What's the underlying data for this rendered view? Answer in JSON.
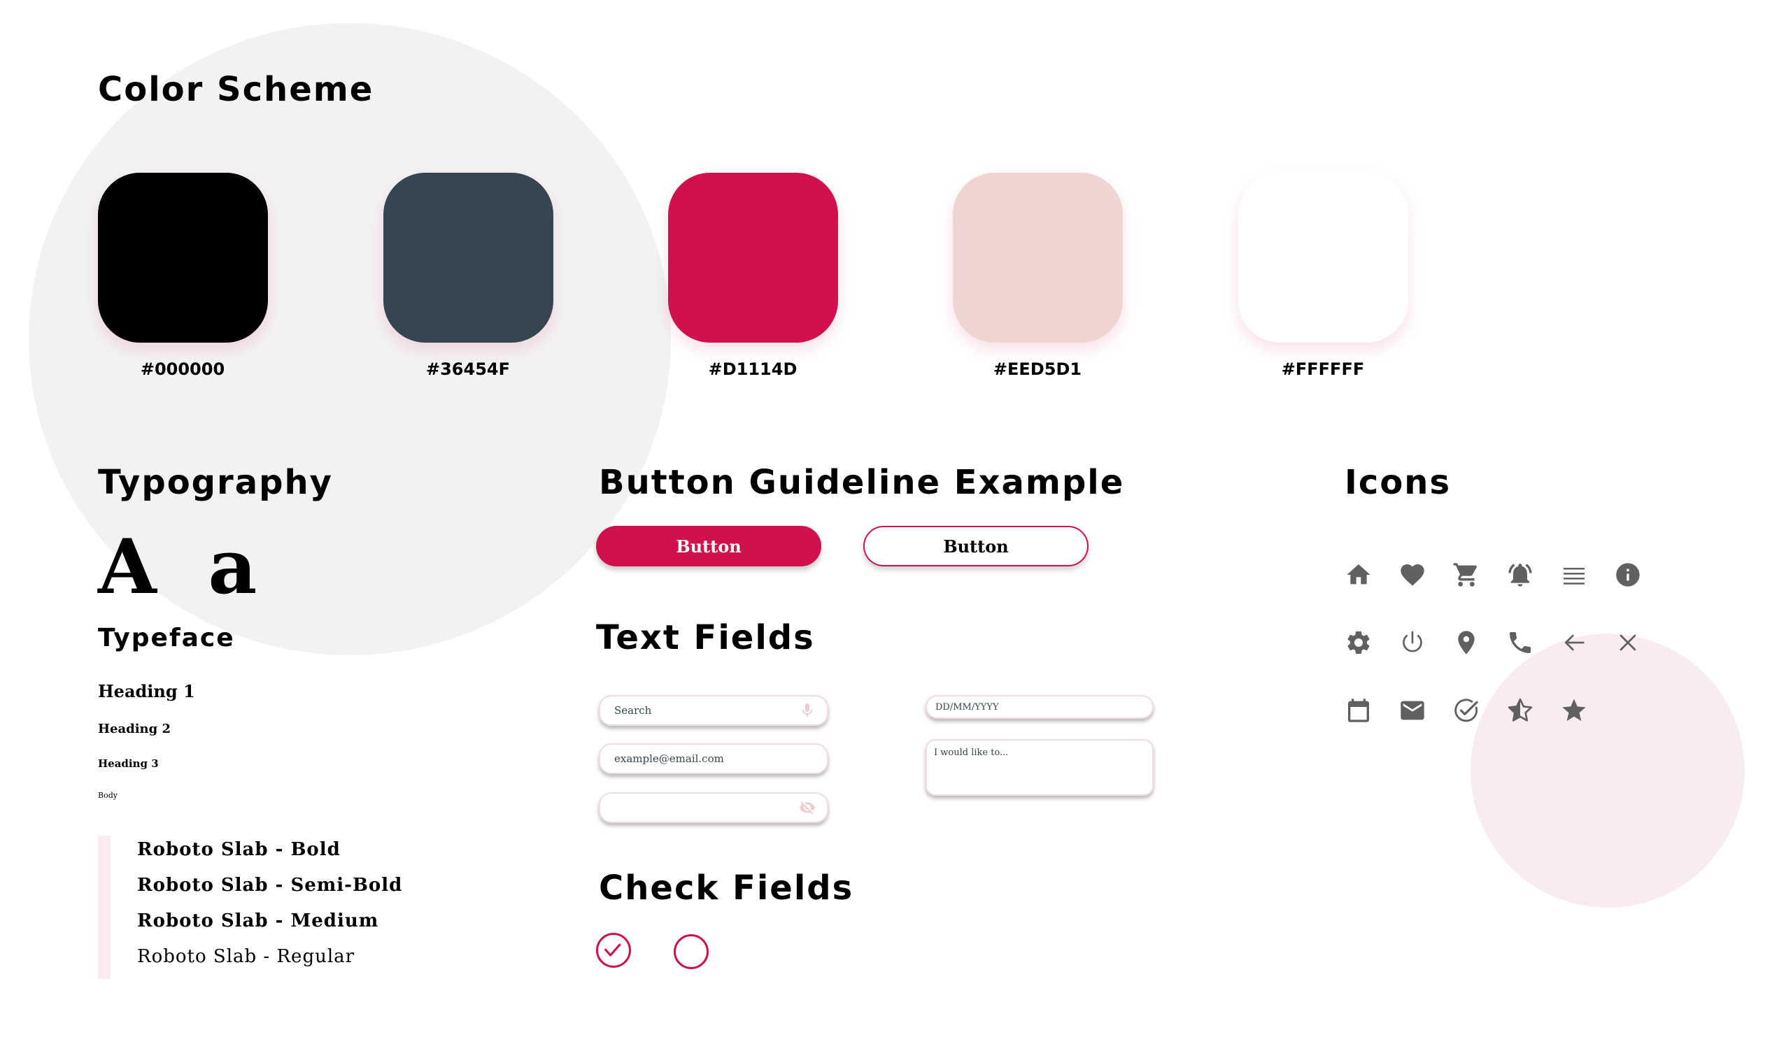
{
  "colors": {
    "section_title": "Color Scheme",
    "swatches": [
      {
        "hex": "#000000",
        "label": "#000000"
      },
      {
        "hex": "#36454F",
        "label": "#36454F"
      },
      {
        "hex": "#D1114D",
        "label": "#D1114D"
      },
      {
        "hex": "#EED5D1",
        "label": "#EED5D1"
      },
      {
        "hex": "#FFFFFF",
        "label": "#FFFFFF"
      }
    ]
  },
  "typography": {
    "section_title": "Typography",
    "sample": "A a",
    "typeface_title": "Typeface",
    "heading1": "Heading 1",
    "heading2": "Heading 2",
    "heading3": "Heading 3",
    "body": "Body",
    "fonts": [
      "Roboto Slab - Bold",
      "Roboto Slab - Semi-Bold",
      "Roboto Slab - Medium",
      "Roboto Slab - Regular"
    ]
  },
  "buttons": {
    "section_title": "Button Guideline Example",
    "primary_label": "Button",
    "outline_label": "Button"
  },
  "text_fields": {
    "section_title": "Text Fields",
    "search_placeholder": "Search",
    "email_value": "example@email.com",
    "password_value": "",
    "date_placeholder": "DD/MM/YYYY",
    "message_placeholder": "I would like to..."
  },
  "check_fields": {
    "section_title": "Check Fields",
    "checked_state": true,
    "unchecked_state": false
  },
  "icons": {
    "section_title": "Icons",
    "color": "#606060",
    "accent": "#D1114D",
    "rows": [
      [
        "home-icon",
        "heart-icon",
        "cart-icon",
        "bell-ringing-icon",
        "menu-icon",
        "info-icon"
      ],
      [
        "gear-icon",
        "power-icon",
        "location-pin-icon",
        "phone-icon",
        "arrow-left-icon",
        "close-icon"
      ],
      [
        "calendar-icon",
        "mail-icon",
        "check-circle-icon",
        "star-half-icon",
        "star-icon"
      ]
    ]
  }
}
